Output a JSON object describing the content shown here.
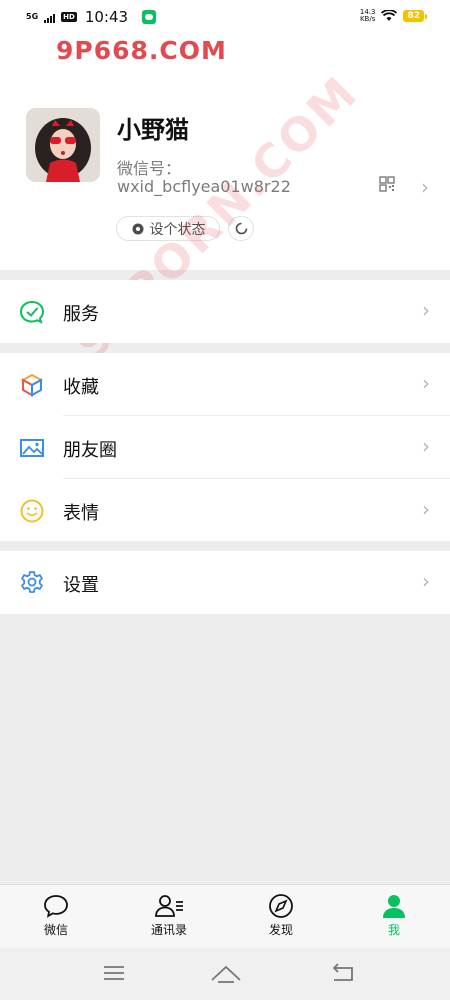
{
  "status_bar": {
    "network": "5G",
    "hd": "HD",
    "time": "10:43",
    "speed_value": "14.3",
    "speed_unit": "KB/s",
    "battery": "82"
  },
  "watermark": {
    "top_text": "9P668.COM",
    "diagonal_text": "91PORN.COM"
  },
  "profile": {
    "name": "小野猫",
    "wechat_id_label": "微信号：",
    "wechat_id": "wxid_bcflyea01w8r22",
    "status_button_label": "设个状态"
  },
  "menu": {
    "services": "服务",
    "favorites": "收藏",
    "moments": "朋友圈",
    "stickers": "表情",
    "settings": "设置",
    "chevron": "›"
  },
  "tabs": [
    {
      "label": "微信",
      "icon": "chat-bubble-icon"
    },
    {
      "label": "通讯录",
      "icon": "contacts-icon"
    },
    {
      "label": "发现",
      "icon": "compass-icon"
    },
    {
      "label": "我",
      "icon": "me-icon"
    }
  ],
  "colors": {
    "accent": "#07c160",
    "watermark": "#e24a4f",
    "background": "#ededed"
  }
}
